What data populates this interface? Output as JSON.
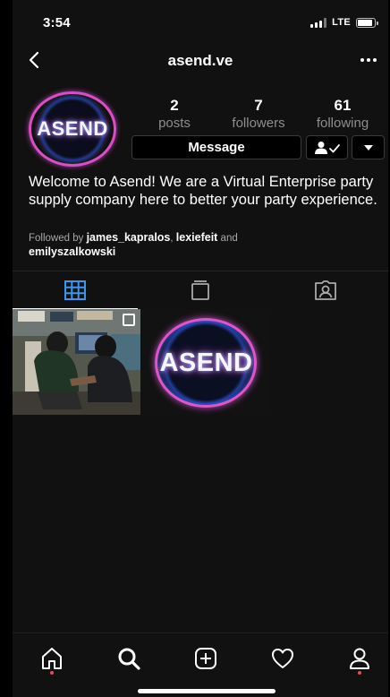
{
  "status_bar": {
    "time": "3:54",
    "network": "LTE"
  },
  "nav": {
    "username": "asend.ve",
    "back_icon": "chevron-left-icon",
    "more_icon": "more-horizontal-icon"
  },
  "profile": {
    "avatar_text": "ASEND",
    "stats": [
      {
        "number": "2",
        "label": "posts"
      },
      {
        "number": "7",
        "label": "followers"
      },
      {
        "number": "61",
        "label": "following"
      }
    ],
    "message_label": "Message",
    "bio": "Welcome to Asend! We are a Virtual Enterprise party supply company here to better your party experience.",
    "followed_by": {
      "prefix": "Followed by",
      "users": [
        "james_kapralos",
        "lexiefeit"
      ],
      "joiner": "and",
      "last_user": "emilyszalkowski"
    }
  },
  "tabs": [
    "grid-icon",
    "igtv-icon",
    "tagged-icon"
  ],
  "posts": [
    {
      "type": "photo",
      "multi": true
    },
    {
      "type": "logo",
      "text": "ASEND"
    }
  ],
  "tab_bar": [
    "home-icon",
    "search-icon",
    "new-post-icon",
    "activity-icon",
    "profile-icon"
  ],
  "colors": {
    "accent_blue": "#3897f0",
    "notification_red": "#ed4956",
    "logo_pink": "#e056c8"
  }
}
